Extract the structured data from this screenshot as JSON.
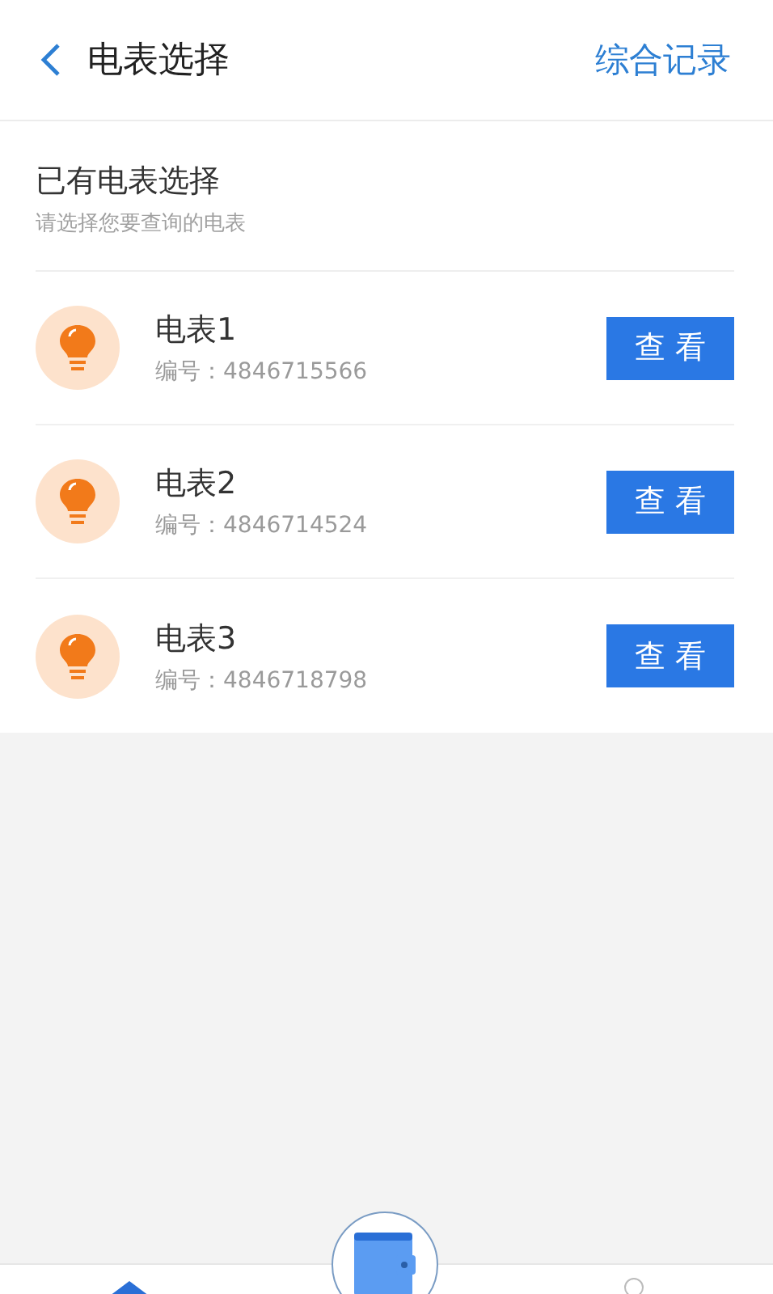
{
  "header": {
    "title": "电表选择",
    "action": "综合记录"
  },
  "section": {
    "title": "已有电表选择",
    "subtitle": "请选择您要查询的电表"
  },
  "meters": [
    {
      "name": "电表1",
      "number": "编号：4846715566",
      "button": "查 看"
    },
    {
      "name": "电表2",
      "number": "编号：4846714524",
      "button": "查 看"
    },
    {
      "name": "电表3",
      "number": "编号：4846718798",
      "button": "查 看"
    }
  ]
}
